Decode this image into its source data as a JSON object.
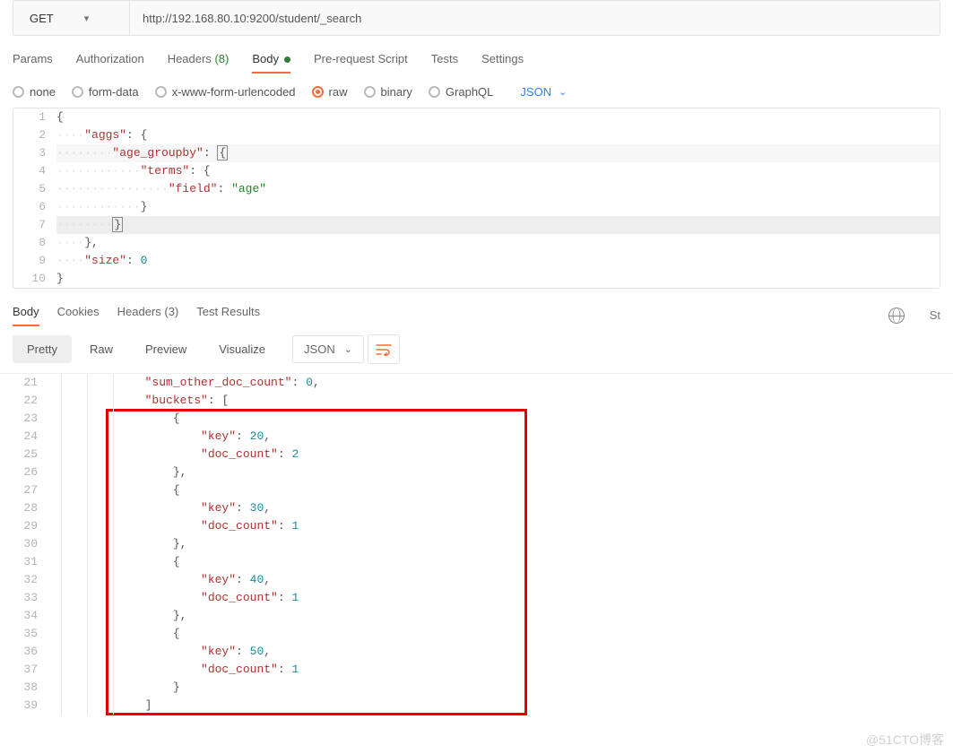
{
  "request": {
    "method": "GET",
    "url": "http://192.168.80.10:9200/student/_search"
  },
  "tabs": {
    "params": "Params",
    "authorization": "Authorization",
    "headers": "Headers",
    "headers_count": "(8)",
    "body": "Body",
    "prerequest": "Pre-request Script",
    "tests": "Tests",
    "settings": "Settings"
  },
  "body_types": {
    "none": "none",
    "formdata": "form-data",
    "xform": "x-www-form-urlencoded",
    "raw": "raw",
    "binary": "binary",
    "graphql": "GraphQL",
    "format": "JSON"
  },
  "request_body_lines": [
    "{",
    "    \"aggs\": {",
    "        \"age_groupby\": {",
    "            \"terms\": {",
    "                \"field\": \"age\"",
    "            }",
    "        }",
    "    },",
    "    \"size\": 0",
    "}"
  ],
  "response_tabs": {
    "body": "Body",
    "cookies": "Cookies",
    "headers": "Headers",
    "headers_count": "(3)",
    "testresults": "Test Results",
    "status_short": "St"
  },
  "view_modes": {
    "pretty": "Pretty",
    "raw": "Raw",
    "preview": "Preview",
    "visualize": "Visualize",
    "format": "JSON"
  },
  "response_lines": [
    {
      "n": 21,
      "text": "            \"sum_other_doc_count\": 0,"
    },
    {
      "n": 22,
      "text": "            \"buckets\": ["
    },
    {
      "n": 23,
      "text": "                {"
    },
    {
      "n": 24,
      "text": "                    \"key\": 20,"
    },
    {
      "n": 25,
      "text": "                    \"doc_count\": 2"
    },
    {
      "n": 26,
      "text": "                },"
    },
    {
      "n": 27,
      "text": "                {"
    },
    {
      "n": 28,
      "text": "                    \"key\": 30,"
    },
    {
      "n": 29,
      "text": "                    \"doc_count\": 1"
    },
    {
      "n": 30,
      "text": "                },"
    },
    {
      "n": 31,
      "text": "                {"
    },
    {
      "n": 32,
      "text": "                    \"key\": 40,"
    },
    {
      "n": 33,
      "text": "                    \"doc_count\": 1"
    },
    {
      "n": 34,
      "text": "                },"
    },
    {
      "n": 35,
      "text": "                {"
    },
    {
      "n": 36,
      "text": "                    \"key\": 50,"
    },
    {
      "n": 37,
      "text": "                    \"doc_count\": 1"
    },
    {
      "n": 38,
      "text": "                }"
    },
    {
      "n": 39,
      "text": "            ]"
    }
  ],
  "colors": {
    "accent": "#ff6c37",
    "link": "#2e7fff",
    "count_green": "#2e7d32",
    "highlight_border": "#e60000"
  },
  "watermark": "@51CTO博客"
}
